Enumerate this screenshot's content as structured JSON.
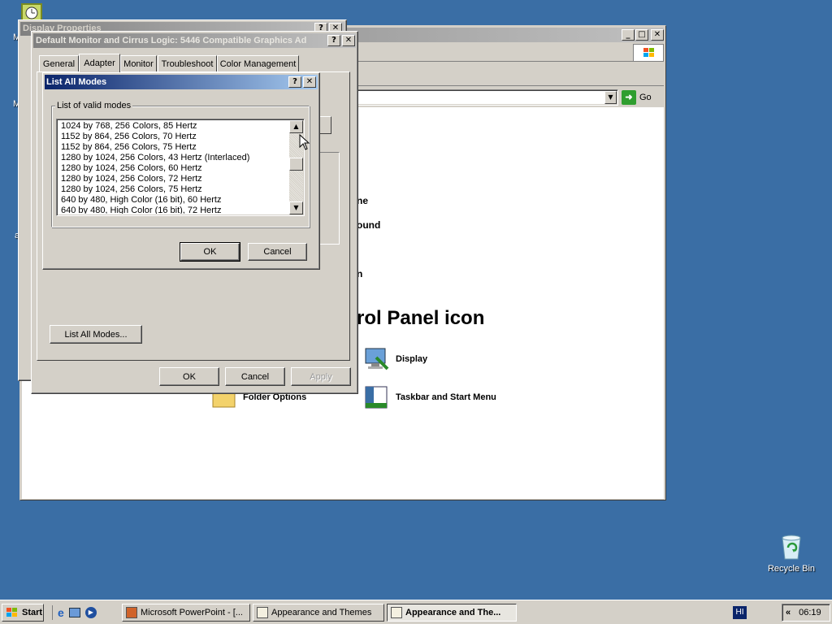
{
  "desktop": {
    "recycle_bin_label": "Recycle Bin",
    "left_edge_glyphs": [
      "M",
      "M",
      "a"
    ]
  },
  "control_panel": {
    "go_label": "Go",
    "heading_partial": "rol Panel icon",
    "partial_labels": [
      "ne",
      "ound",
      "n"
    ],
    "icons": [
      {
        "label": "Display",
        "icon": "display-icon"
      },
      {
        "label": "Folder Options",
        "icon": "folder-options-icon"
      },
      {
        "label": "Taskbar and Start Menu",
        "icon": "taskbar-icon"
      }
    ]
  },
  "display_properties": {
    "title": "Display Properties",
    "help": "?",
    "close": "✕"
  },
  "adapter_dialog": {
    "title": "Default Monitor and Cirrus Logic: 5446 Compatible Graphics Ad",
    "tabs": [
      "General",
      "Adapter",
      "Monitor",
      "Troubleshoot",
      "Color Management"
    ],
    "selected_tab": "Adapter",
    "list_all_modes_button": "List All Modes...",
    "ok": "OK",
    "cancel": "Cancel",
    "apply": "Apply"
  },
  "list_modes_dialog": {
    "title": "List All Modes",
    "group_label": "List of valid modes",
    "modes": [
      "1024 by 768, 256 Colors, 85 Hertz",
      "1152 by 864, 256 Colors, 70 Hertz",
      "1152 by 864, 256 Colors, 75 Hertz",
      "1280 by 1024, 256 Colors, 43 Hertz (Interlaced)",
      "1280 by 1024, 256 Colors, 60 Hertz",
      "1280 by 1024, 256 Colors, 72 Hertz",
      "1280 by 1024, 256 Colors, 75 Hertz",
      "640 by 480, High Color (16 bit), 60 Hertz",
      "640 by 480, High Color (16 bit), 72 Hertz"
    ],
    "ok": "OK",
    "cancel": "Cancel"
  },
  "taskbar": {
    "start_label": "Start",
    "tasks": [
      {
        "label": "Microsoft PowerPoint - [...",
        "active": false
      },
      {
        "label": "Appearance and Themes",
        "active": false
      },
      {
        "label": "Appearance and The...",
        "active": true
      }
    ],
    "language": "HI",
    "chevron": "«",
    "clock": "06:19"
  },
  "colors": {
    "desktop": "#3a6ea5",
    "active_title_start": "#0a246a",
    "active_title_end": "#a6caf0",
    "face": "#d4d0c8"
  }
}
